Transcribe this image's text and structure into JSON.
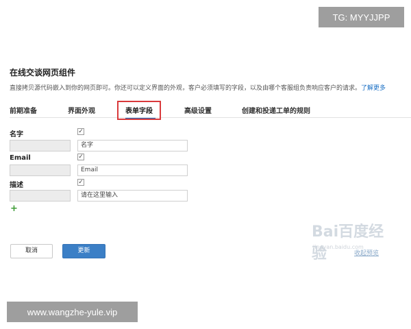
{
  "overlays": {
    "top": "TG: MYYJJPP",
    "bottom": "www.wangzhe-yule.vip"
  },
  "page": {
    "title": "在线交谈网页组件",
    "description": "直接拷贝源代码嵌入到你的网页即可。你还可以定义界面的外观，客户必须填写的字段，以及由哪个客服组负责响应客户的请求。",
    "learn_more": "了解更多"
  },
  "tabs": [
    {
      "label": "前期准备"
    },
    {
      "label": "界面外观"
    },
    {
      "label": "表单字段"
    },
    {
      "label": "高级设置"
    },
    {
      "label": "创建和投递工单的规则"
    }
  ],
  "active_tab": "表单字段",
  "fields": [
    {
      "label": "名字",
      "checked": true,
      "value": "名字"
    },
    {
      "label": "Email",
      "checked": true,
      "value": "Email"
    },
    {
      "label": "描述",
      "checked": true,
      "value": "请在这里输入"
    }
  ],
  "add_icon": "plus-icon",
  "buttons": {
    "cancel": "取消",
    "update": "更新"
  },
  "watermark": {
    "brand": "Bai百度经验",
    "sub": "jingyan.baidu.com",
    "link": "收起预览"
  },
  "colors": {
    "accent": "#3b7fc6",
    "highlight_border": "#d9393b",
    "add": "#3d9b35"
  }
}
